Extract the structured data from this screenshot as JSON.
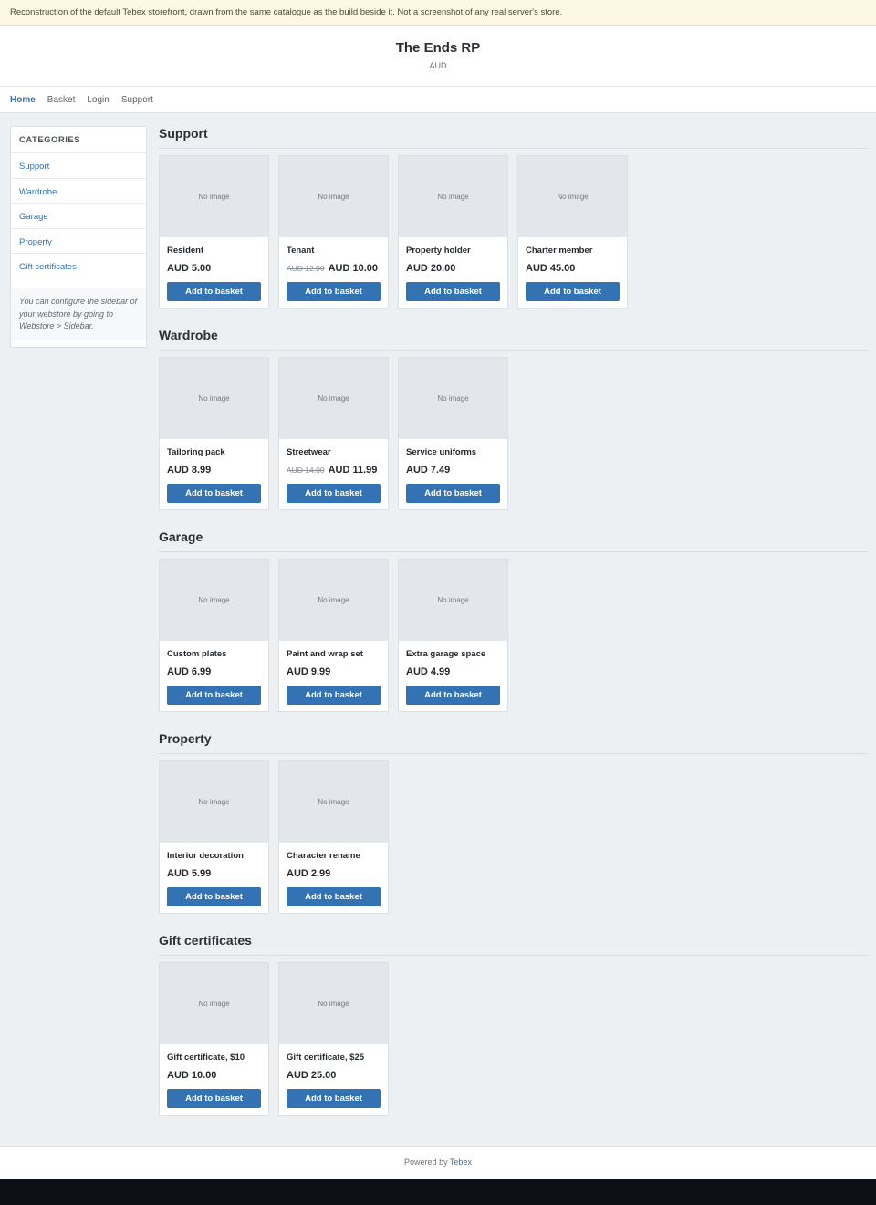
{
  "notice": "Reconstruction of the default Tebex storefront, drawn from the same catalogue as the build beside it. Not a screenshot of any real server's store.",
  "header": {
    "title": "The Ends RP",
    "currency": "AUD"
  },
  "nav": {
    "home": "Home",
    "basket": "Basket",
    "login": "Login",
    "support": "Support"
  },
  "sidebar": {
    "heading": "CATEGORIES",
    "items": [
      "Support",
      "Wardrobe",
      "Garage",
      "Property",
      "Gift certificates"
    ],
    "note": "You can configure the sidebar of your webstore by going to Webstore > Sidebar."
  },
  "placeholder": "No image",
  "button_label": "Add to basket",
  "categories": [
    {
      "title": "Support",
      "packages": [
        {
          "name": "Resident",
          "old_price": "",
          "price": "AUD 5.00"
        },
        {
          "name": "Tenant",
          "old_price": "AUD 12.00",
          "price": "AUD 10.00"
        },
        {
          "name": "Property holder",
          "old_price": "",
          "price": "AUD 20.00"
        },
        {
          "name": "Charter member",
          "old_price": "",
          "price": "AUD 45.00"
        }
      ]
    },
    {
      "title": "Wardrobe",
      "packages": [
        {
          "name": "Tailoring pack",
          "old_price": "",
          "price": "AUD 8.99"
        },
        {
          "name": "Streetwear",
          "old_price": "AUD 14.00",
          "price": "AUD 11.99"
        },
        {
          "name": "Service uniforms",
          "old_price": "",
          "price": "AUD 7.49"
        }
      ]
    },
    {
      "title": "Garage",
      "packages": [
        {
          "name": "Custom plates",
          "old_price": "",
          "price": "AUD 6.99"
        },
        {
          "name": "Paint and wrap set",
          "old_price": "",
          "price": "AUD 9.99"
        },
        {
          "name": "Extra garage space",
          "old_price": "",
          "price": "AUD 4.99"
        }
      ]
    },
    {
      "title": "Property",
      "packages": [
        {
          "name": "Interior decoration",
          "old_price": "",
          "price": "AUD 5.99"
        },
        {
          "name": "Character rename",
          "old_price": "",
          "price": "AUD 2.99"
        }
      ]
    },
    {
      "title": "Gift certificates",
      "packages": [
        {
          "name": "Gift certificate, $10",
          "old_price": "",
          "price": "AUD 10.00"
        },
        {
          "name": "Gift certificate, $25",
          "old_price": "",
          "price": "AUD 25.00"
        }
      ]
    }
  ],
  "footer": {
    "prefix": "Powered by",
    "link": "Tebex"
  }
}
